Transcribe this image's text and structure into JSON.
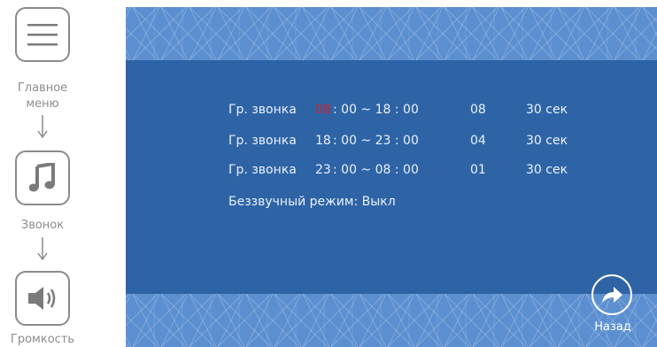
{
  "breadcrumb": {
    "items": [
      {
        "label": "Главное\nменю",
        "icon": "menu-icon"
      },
      {
        "label": "Звонок",
        "icon": "music-note-icon"
      },
      {
        "label": "Громкость",
        "icon": "speaker-icon"
      }
    ]
  },
  "schedule": {
    "rows": [
      {
        "label": "Гр. звонка",
        "start_hour": "08",
        "start_rest": ": 00 ~ 18 : 00",
        "volume": "08",
        "duration": "30 сек",
        "highlight_start_hour": true
      },
      {
        "label": "Гр. звонка",
        "start_hour": "18",
        "start_rest": ": 00 ~ 23 : 00",
        "volume": "04",
        "duration": "30 сек",
        "highlight_start_hour": false
      },
      {
        "label": "Гр. звонка",
        "start_hour": "23",
        "start_rest": ": 00 ~ 08 : 00",
        "volume": "01",
        "duration": "30 сек",
        "highlight_start_hour": false
      }
    ],
    "silent_mode": "Беззвучный режим: Выкл"
  },
  "back": {
    "label": "Назад",
    "icon": "back-arrow-icon"
  },
  "colors": {
    "screen": "#2e64a6",
    "band": "#5b8fd0",
    "highlight": "#d4202a",
    "text": "#e9f1fb",
    "breadcrumb_text": "#8c8c8c"
  }
}
